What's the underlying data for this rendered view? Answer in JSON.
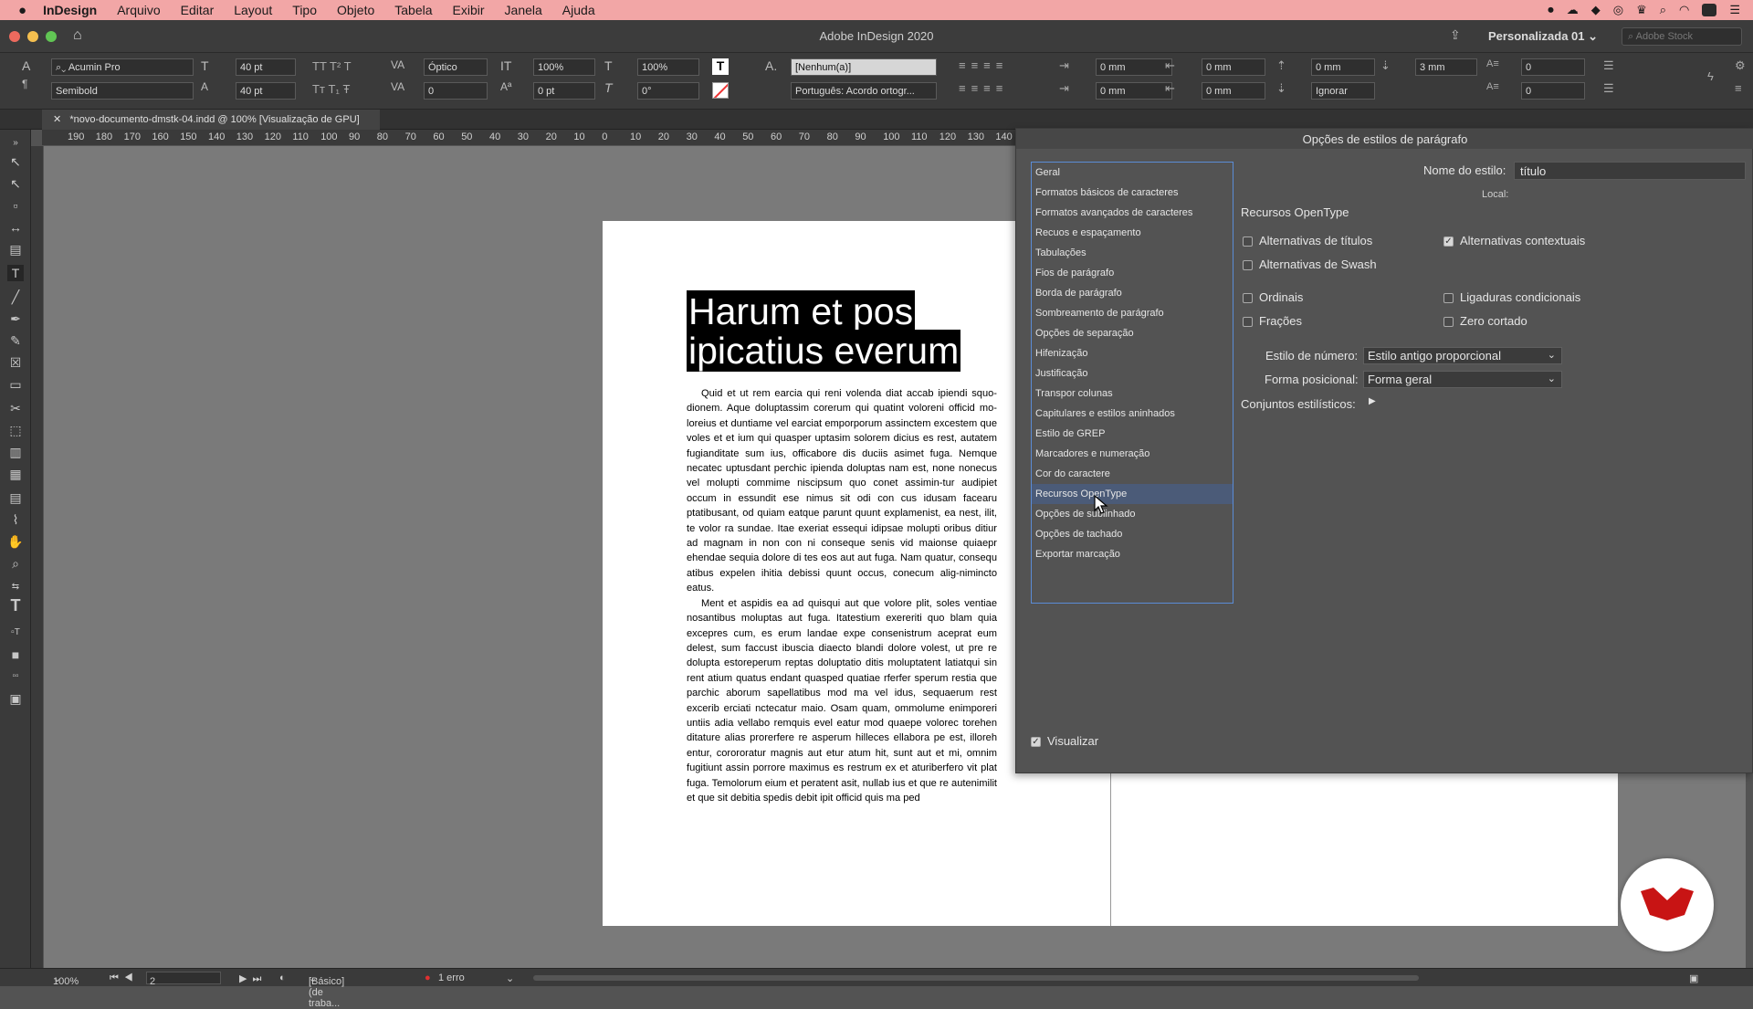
{
  "menubar": {
    "app": "InDesign",
    "items": [
      "Arquivo",
      "Editar",
      "Layout",
      "Tipo",
      "Objeto",
      "Tabela",
      "Exibir",
      "Janela",
      "Ajuda"
    ]
  },
  "window": {
    "title": "Adobe InDesign 2020",
    "workspace": "Personalizada 01",
    "stock_placeholder": "Adobe Stock"
  },
  "control": {
    "font_family": "Acumin Pro",
    "font_style": "Semibold",
    "font_size": "40 pt",
    "leading": "40 pt",
    "kerning": "Óptico",
    "tracking": "0",
    "vscale": "100%",
    "hscale": "100%",
    "baseline": "0 pt",
    "skew": "0°",
    "char_style": "[Nenhum(a)]",
    "language": "Português: Acordo ortogr...",
    "left_indent": "0 mm",
    "first_indent": "0 mm",
    "right_indent": "0 mm",
    "last_indent": "0 mm",
    "space_before": "0 mm",
    "space_after": "3 mm",
    "grid_align": "Ignorar",
    "dropcap_lines": "0",
    "dropcap_chars": "0"
  },
  "doc_tab": {
    "title": "*novo-documento-dmstk-04.indd @ 100% [Visualização de GPU]"
  },
  "ruler": {
    "labels": [
      "190",
      "180",
      "170",
      "160",
      "150",
      "140",
      "130",
      "120",
      "110",
      "100",
      "90",
      "80",
      "70",
      "60",
      "50",
      "40",
      "30",
      "20",
      "10",
      "0",
      "10",
      "20",
      "30",
      "40",
      "50",
      "60",
      "70",
      "80",
      "90",
      "100",
      "110",
      "120",
      "130",
      "140"
    ]
  },
  "document": {
    "headline": "Harum et pos ipicatius everum",
    "para1": "Quid et ut rem earcia qui reni volenda diat accab ipiendi squo-dionem. Aque doluptassim corerum qui quatint voloreni officid mo-loreius et duntiame vel earciat emporporum assinctem excestem que voles et et ium qui quasper uptasim solorem dicius es rest, autatem fugianditate sum ius, officabore dis duciis asimet fuga. Nemque necatec uptusdant perchic ipienda doluptas nam est, none nonecus vel molupti commime niscipsum quo conet assimin-tur audipiet occum in essundit ese nimus sit odi con cus idusam facearu ptatibusant, od quiam eatque parunt quunt explamenist, ea nest, ilit, te volor ra sundae. Itae exeriat essequi idipsae molupti oribus ditiur ad magnam in non con ni conseque senis vid maionse quiaepr ehendae sequia dolore di tes eos aut aut fuga. Nam quatur, consequ atibus expelen ihitia debissi quunt occus, conecum alig-nimincto eatus.",
    "para2": "Ment et aspidis ea ad quisqui aut que volore plit, soles ventiae nosantibus moluptas aut fuga. Itatestium exereriti quo blam quia excepres cum, es erum landae expe consenistrum aceprat eum delest, sum faccust ibuscia diaecto blandi dolore volest, ut pre re dolupta estoreperum reptas doluptatio ditis moluptatent latiatqui sin rent atium quatus endant quasped quatiae rferfer sperum restia que parchic aborum sapellatibus mod ma vel idus, sequaerum rest excerib erciati nctecatur maio. Osam quam, ommolume enimporeri untiis adia vellabo remquis evel eatur mod quaepe volorec torehen ditature alias prorerfere re asperum hilleces ellabora pe est, illoreh entur, corororatur magnis aut etur atum hit, sunt aut et mi, omnim fugitiunt assin porrore maximus es restrum ex et aturiberfero vit plat fuga. Temolorum eium et peratent asit, nullab ius et que re autenimilit et que sit debitia spedis debit ipit officid quis ma ped"
  },
  "dialog": {
    "title": "Opções de estilos de parágrafo",
    "categories": [
      "Geral",
      "Formatos básicos de caracteres",
      "Formatos avançados de caracteres",
      "Recuos e espaçamento",
      "Tabulações",
      "Fios de parágrafo",
      "Borda de parágrafo",
      "Sombreamento de parágrafo",
      "Opções de separação",
      "Hifenização",
      "Justificação",
      "Transpor colunas",
      "Capitulares e estilos aninhados",
      "Estilo de GREP",
      "Marcadores e numeração",
      "Cor do caractere",
      "Recursos OpenType",
      "Opções de sublinhado",
      "Opções de tachado",
      "Exportar marcação"
    ],
    "selected_category": "Recursos OpenType",
    "style_name_label": "Nome do estilo:",
    "style_name": "título",
    "local_label": "Local:",
    "section_title": "Recursos OpenType",
    "checkboxes": [
      {
        "label": "Alternativas de títulos",
        "checked": false
      },
      {
        "label": "Alternativas contextuais",
        "checked": true
      },
      {
        "label": "Alternativas de Swash",
        "checked": false
      },
      {
        "label": "Ordinais",
        "checked": false
      },
      {
        "label": "Ligaduras condicionais",
        "checked": false
      },
      {
        "label": "Frações",
        "checked": false
      },
      {
        "label": "Zero cortado",
        "checked": false
      }
    ],
    "number_style_label": "Estilo de número:",
    "number_style": "Estilo antigo proporcional",
    "position_label": "Forma posicional:",
    "position": "Forma geral",
    "stylistic_sets_label": "Conjuntos estilísticos:",
    "preview_label": "Visualizar",
    "preview_checked": true
  },
  "status": {
    "zoom": "100%",
    "page": "2",
    "profile": "[Básico] (de traba...",
    "errors": "1 erro"
  }
}
